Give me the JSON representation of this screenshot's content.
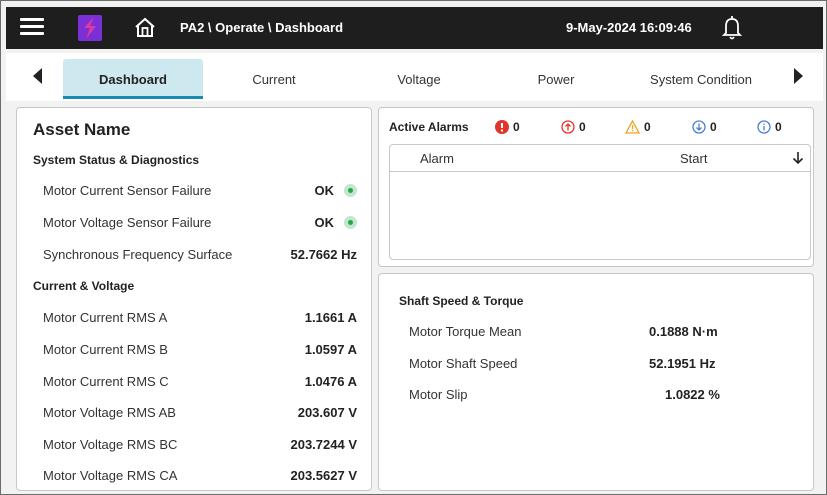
{
  "header": {
    "breadcrumb": "PA2 \\ Operate \\ Dashboard",
    "datetime": "9-May-2024 16:09:46"
  },
  "tabs": [
    {
      "label": "Dashboard",
      "active": true
    },
    {
      "label": "Current"
    },
    {
      "label": "Voltage"
    },
    {
      "label": "Power"
    },
    {
      "label": "System Condition"
    }
  ],
  "asset": {
    "title": "Asset Name",
    "status_section": "System Status & Diagnostics",
    "status_rows": [
      {
        "label": "Motor Current Sensor Failure",
        "value": "OK"
      },
      {
        "label": "Motor Voltage Sensor Failure",
        "value": "OK"
      },
      {
        "label": "Synchronous Frequency Surface",
        "value": "52.7662 Hz"
      }
    ],
    "cv_section": "Current & Voltage",
    "cv_rows": [
      {
        "label": "Motor Current RMS A",
        "value": "1.1661 A"
      },
      {
        "label": "Motor Current RMS B",
        "value": "1.0597 A"
      },
      {
        "label": "Motor Current RMS C",
        "value": "1.0476 A"
      },
      {
        "label": "Motor Voltage RMS AB",
        "value": "203.607 V"
      },
      {
        "label": "Motor Voltage RMS BC",
        "value": "203.7244 V"
      },
      {
        "label": "Motor Voltage RMS CA",
        "value": "203.5627 V"
      }
    ]
  },
  "alarms": {
    "title": "Active Alarms",
    "counts": {
      "critical": "0",
      "high": "0",
      "warning": "0",
      "low": "0",
      "info": "0"
    },
    "columns": {
      "alarm": "Alarm",
      "start": "Start"
    }
  },
  "shaft": {
    "title": "Shaft Speed & Torque",
    "rows": [
      {
        "label": "Motor Torque Mean",
        "value": "0.1888 N·m"
      },
      {
        "label": "Motor Shaft Speed",
        "value": "52.1951 Hz"
      },
      {
        "label": "Motor Slip",
        "value": "1.0822 %"
      }
    ]
  },
  "colors": {
    "accent": "#1b8ab3",
    "tab_active_bg": "#cde8ee",
    "logo": "#7b2fd6",
    "ok": "#2ba24c",
    "critical": "#e0352b",
    "warning": "#f0a020",
    "low": "#4a7fd4"
  }
}
